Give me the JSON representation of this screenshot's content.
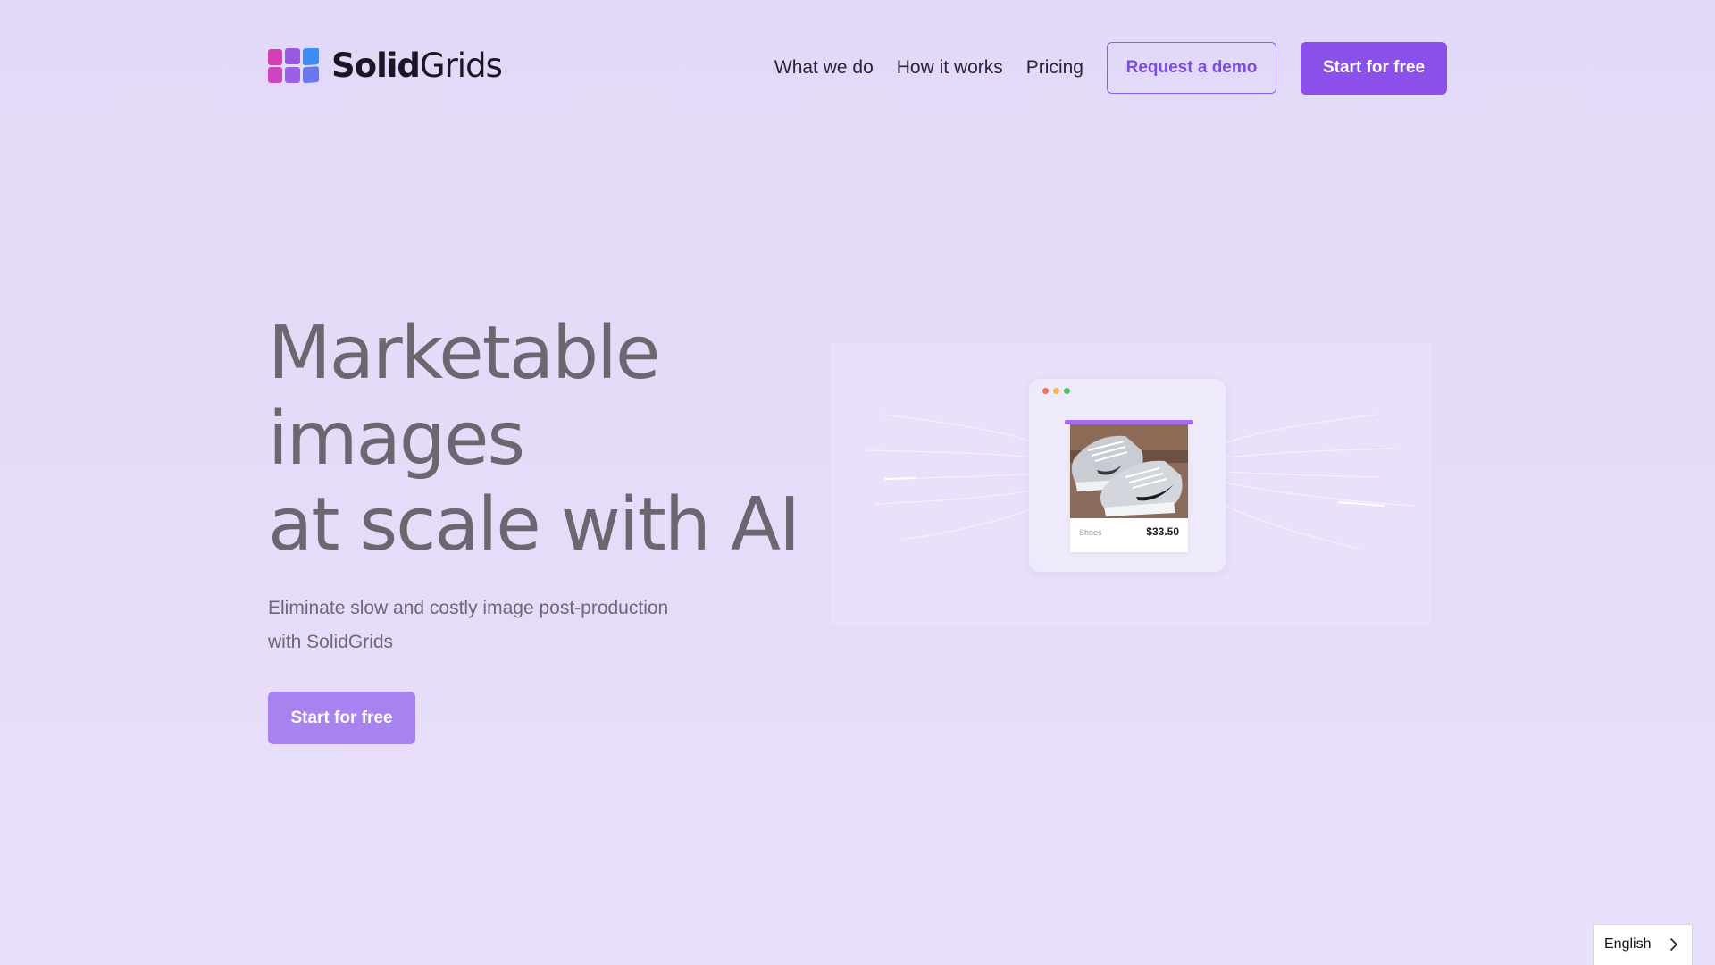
{
  "brand": {
    "name_bold": "Solid",
    "name_light": "Grids",
    "logo_colors": [
      "#d93fb8",
      "#b45be0",
      "#7b6cf0",
      "#3f8cf2"
    ]
  },
  "nav": {
    "links": [
      "What we do",
      "How it works",
      "Pricing"
    ],
    "demo_label": "Request a demo",
    "start_label": "Start for free"
  },
  "hero": {
    "title_lines": [
      "Marketable",
      "images",
      "at scale with AI"
    ],
    "subtitle_lines": [
      "Eliminate slow and costly image post-production",
      "with SolidGrids"
    ],
    "cta_label": "Start for free"
  },
  "illustration": {
    "product_label": "Shoes",
    "product_price": "$33.50"
  },
  "language": {
    "current": "English"
  },
  "colors": {
    "accent": "#8b4fea",
    "accent_light": "#a883ef",
    "background": "#e3dbf8"
  }
}
